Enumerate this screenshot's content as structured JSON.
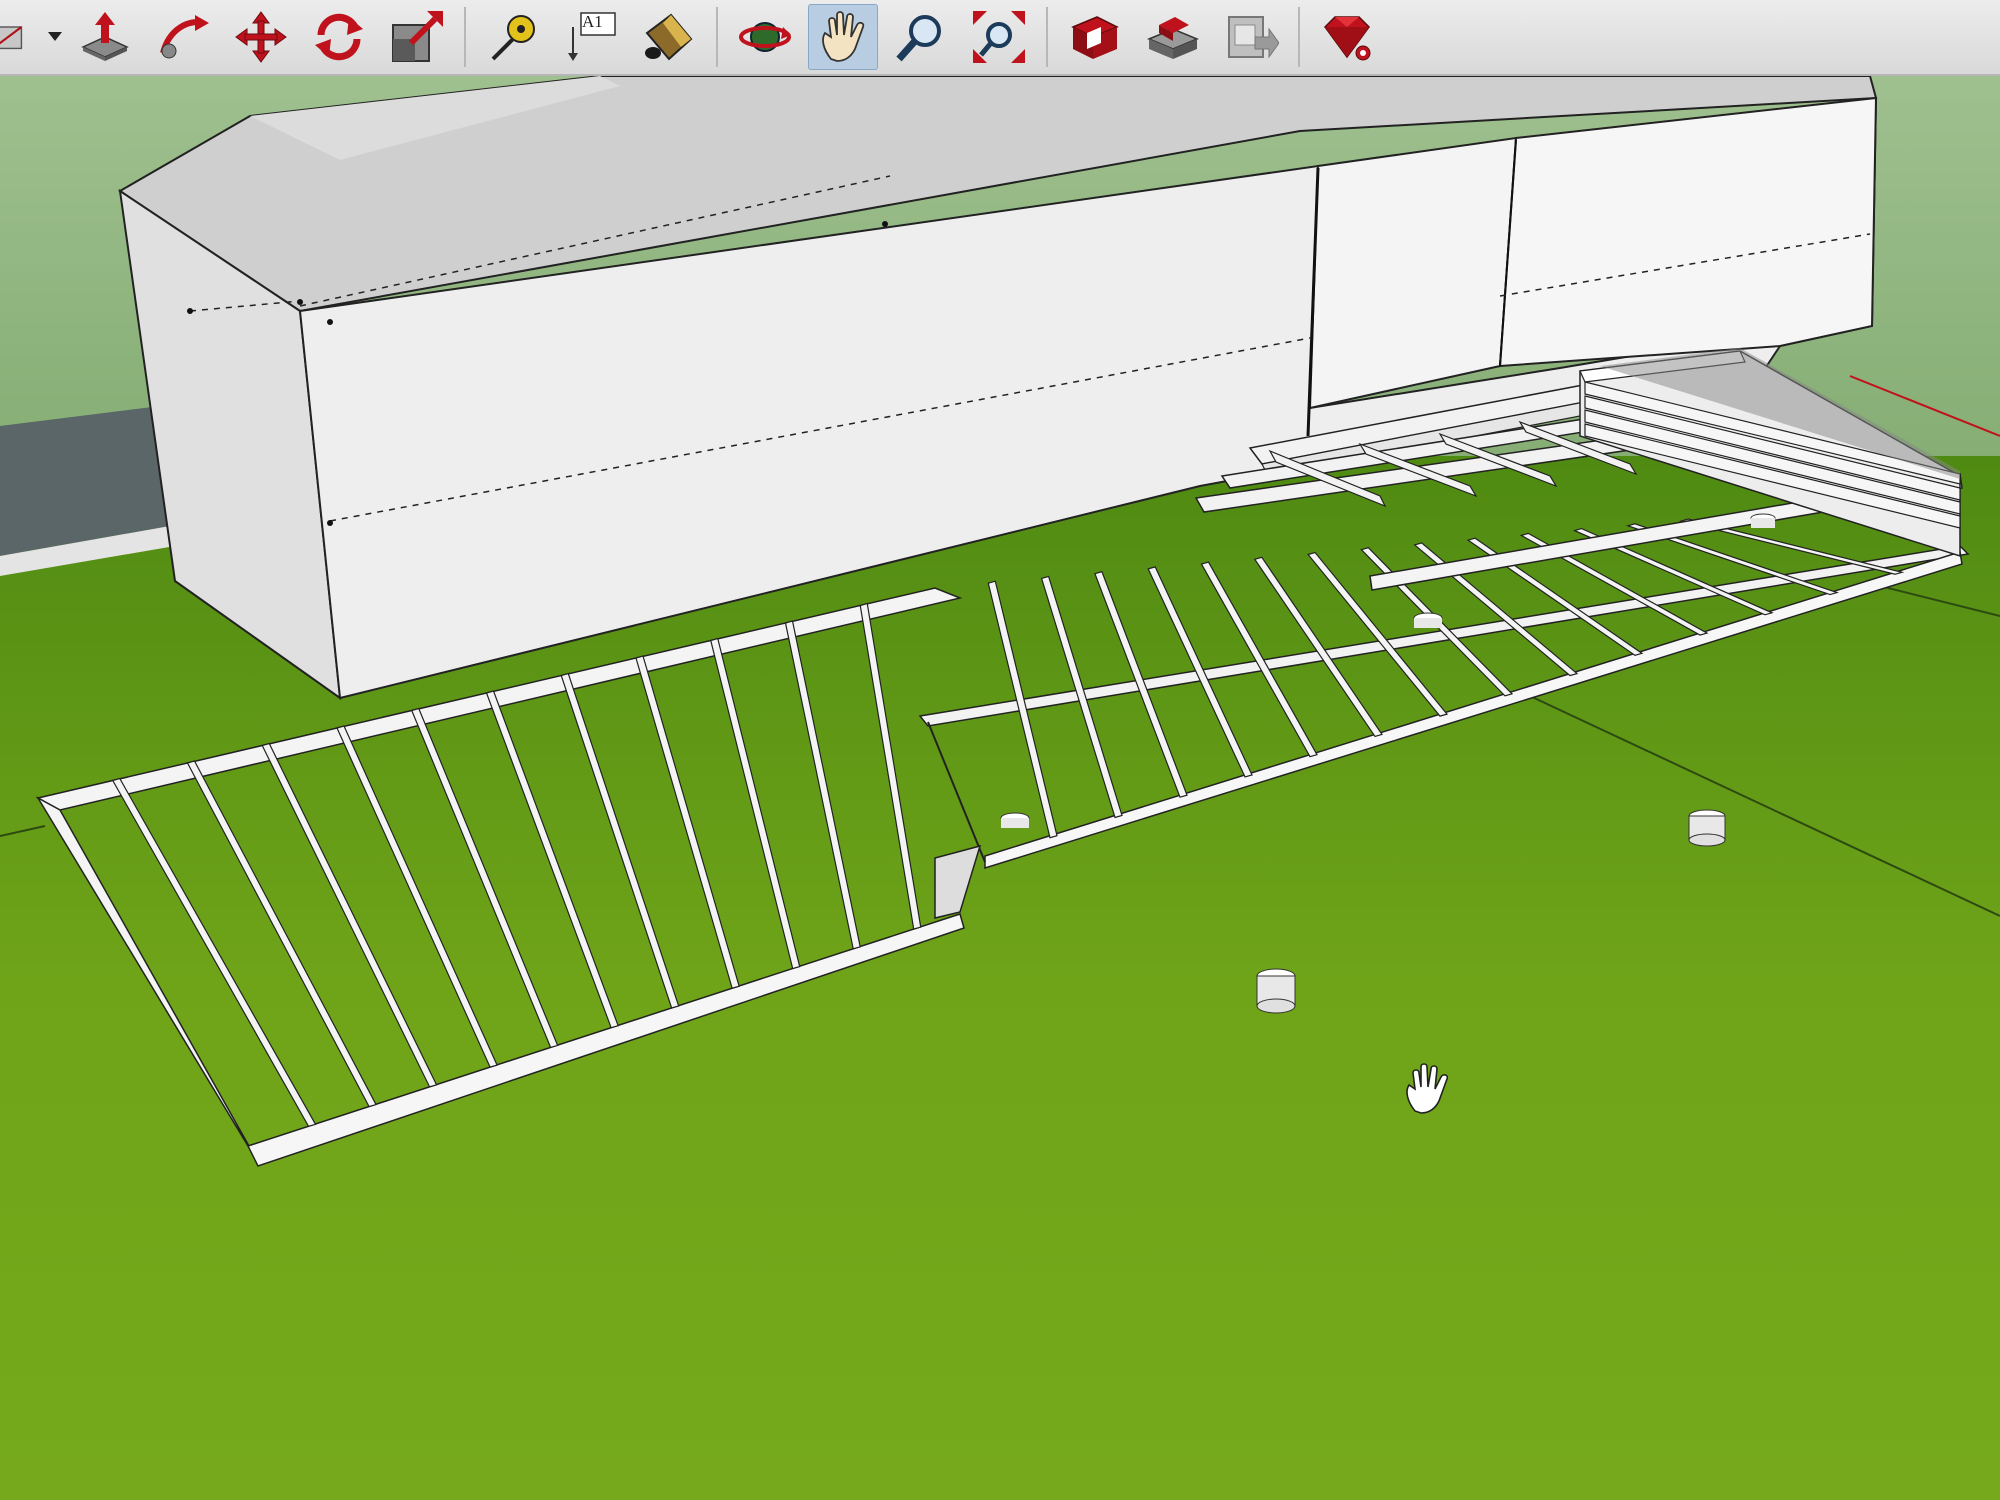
{
  "toolbar": {
    "groups": [
      {
        "tools": [
          {
            "name": "rectangle-tool",
            "icon": "rectangle-icon"
          },
          {
            "name": "push-pull-tool",
            "icon": "push-pull-icon"
          },
          {
            "name": "follow-me-tool",
            "icon": "follow-me-icon"
          },
          {
            "name": "move-tool",
            "icon": "move-icon"
          },
          {
            "name": "rotate-tool",
            "icon": "rotate-icon"
          },
          {
            "name": "scale-tool",
            "icon": "scale-icon"
          }
        ]
      },
      {
        "tools": [
          {
            "name": "tape-measure-tool",
            "icon": "tape-measure-icon"
          },
          {
            "name": "text-tool",
            "icon": "text-icon",
            "text": "A1"
          },
          {
            "name": "paint-bucket-tool",
            "icon": "paint-bucket-icon"
          }
        ]
      },
      {
        "tools": [
          {
            "name": "orbit-tool",
            "icon": "orbit-icon"
          },
          {
            "name": "pan-tool",
            "icon": "pan-hand-icon",
            "active": true
          },
          {
            "name": "zoom-tool",
            "icon": "zoom-icon"
          },
          {
            "name": "zoom-extents-tool",
            "icon": "zoom-extents-icon"
          }
        ]
      },
      {
        "tools": [
          {
            "name": "3d-warehouse-tool",
            "icon": "warehouse-icon"
          },
          {
            "name": "share-model-tool",
            "icon": "share-model-icon"
          },
          {
            "name": "send-to-layout-tool",
            "icon": "layout-icon"
          }
        ]
      },
      {
        "tools": [
          {
            "name": "extension-warehouse-tool",
            "icon": "ruby-gem-icon"
          }
        ]
      }
    ]
  },
  "viewport": {
    "cursor_icon": "pan-hand-cursor-icon",
    "colors": {
      "ground": "#6c9a1e",
      "sky": "#8fb87a",
      "wall": "#ececec",
      "roof": "#cfcfcf",
      "accent_red": "#c0121c"
    }
  }
}
